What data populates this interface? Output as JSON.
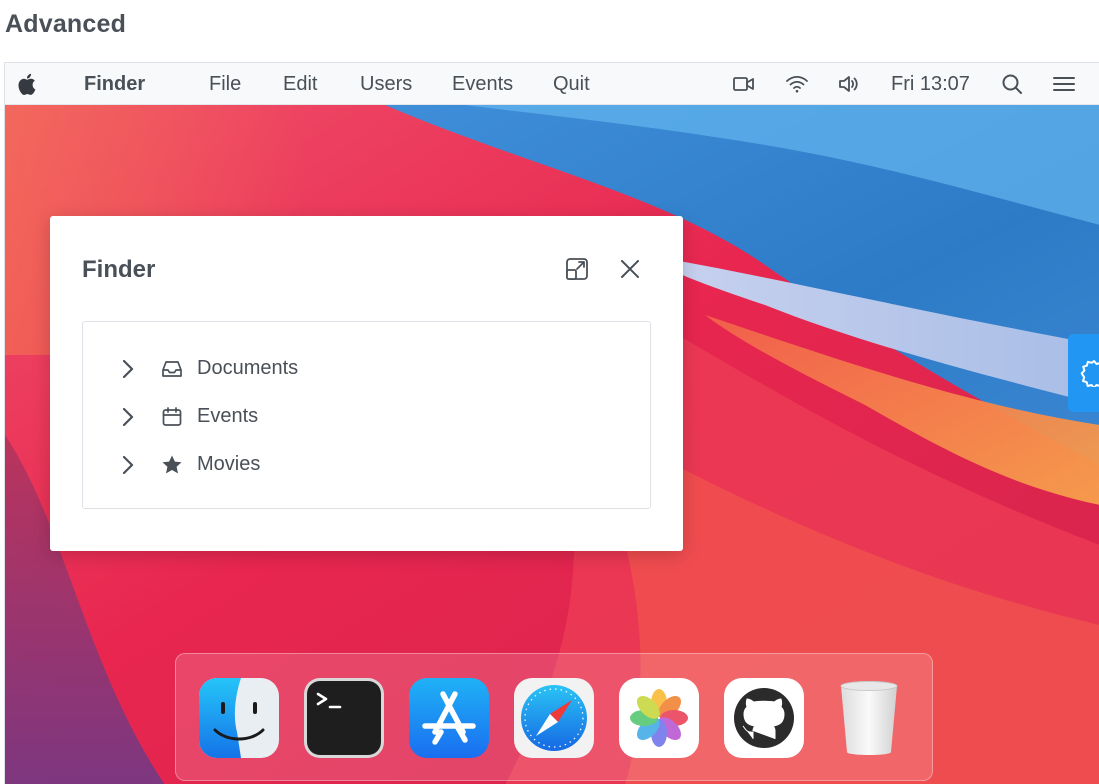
{
  "page": {
    "heading": "Advanced"
  },
  "menubar": {
    "app_name": "Finder",
    "items": [
      {
        "label": "File"
      },
      {
        "label": "Edit"
      },
      {
        "label": "Users"
      },
      {
        "label": "Events"
      },
      {
        "label": "Quit"
      }
    ],
    "status_icons": [
      "video-icon",
      "wifi-icon",
      "volume-icon"
    ],
    "clock": "Fri 13:07",
    "right_icons": [
      "search-icon",
      "menu-icon"
    ]
  },
  "finder": {
    "title": "Finder",
    "window_buttons": [
      "maximize-icon",
      "close-icon"
    ],
    "tree": [
      {
        "label": "Documents",
        "icon": "inbox-icon",
        "expanded": false
      },
      {
        "label": "Events",
        "icon": "calendar-icon",
        "expanded": false
      },
      {
        "label": "Movies",
        "icon": "star-icon",
        "expanded": false
      }
    ]
  },
  "side_tab": {
    "icon": "cog-icon",
    "color": "#2196f3"
  },
  "dock": {
    "items": [
      {
        "name": "Finder",
        "icon": "finder-icon"
      },
      {
        "name": "Terminal",
        "icon": "terminal-icon"
      },
      {
        "name": "App Store",
        "icon": "app-store-icon"
      },
      {
        "name": "Safari",
        "icon": "safari-icon"
      },
      {
        "name": "Photos",
        "icon": "photos-icon"
      },
      {
        "name": "GitHub",
        "icon": "github-icon"
      },
      {
        "name": "Trash",
        "icon": "trash-icon"
      }
    ]
  },
  "colors": {
    "menubar_bg": "#f8f9fa",
    "text": "#495057",
    "accent": "#2196f3"
  }
}
